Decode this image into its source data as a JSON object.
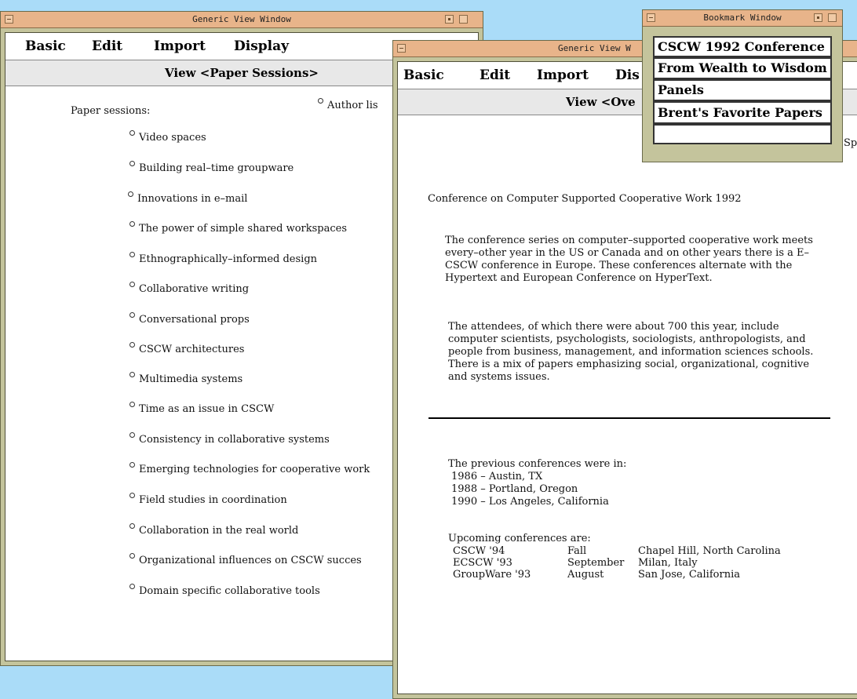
{
  "window1": {
    "title": "Generic View Window",
    "menu": [
      "Basic",
      "Edit",
      "Import",
      "Display"
    ],
    "view_title": "View <Paper Sessions>",
    "heading": "Paper sessions:",
    "author_link": "Author lis",
    "sessions": [
      "Video spaces",
      "Building real–time groupware",
      "Innovations in e–mail",
      "The power of simple shared workspaces",
      "Ethnographically–informed design",
      "Collaborative writing",
      "Conversational props",
      "CSCW architectures",
      "Multimedia systems",
      "Time as an issue in CSCW",
      "Consistency in collaborative systems",
      "Emerging technologies for cooperative work",
      "Field studies in coordination",
      "Collaboration in the real world",
      "Organizational influences on CSCW succes",
      "Domain specific collaborative tools"
    ]
  },
  "window2": {
    "title": "Generic View W",
    "menu": [
      "Basic",
      "Edit",
      "Import",
      "Dis"
    ],
    "view_title": "View <Ove",
    "corner_text": "Sp",
    "conference_title": "Conference on Computer Supported Cooperative Work 1992",
    "para1": "The conference series  on computer–supported cooperative work meets every–other year in the US or Canada and on other years there is a E–CSCW conference in Europe.  These conferences alternate with the Hypertext and European Conference on HyperText.",
    "para2": "The attendees, of which there were about 700 this year, include computer scientists, psychologists, sociologists, anthropologists, and people from business, management, and information sciences schools.  There is a mix of papers emphasizing social, organizational, cognitive and systems issues.",
    "previous_heading": "The previous conferences were in:",
    "previous": [
      "1986 – Austin, TX",
      "1988 – Portland, Oregon",
      "1990 – Los Angeles, California"
    ],
    "upcoming_heading": "Upcoming conferences are:",
    "upcoming": [
      {
        "name": "CSCW '94",
        "when": "Fall",
        "where": "Chapel Hill, North Carolina"
      },
      {
        "name": "ECSCW '93",
        "when": "September",
        "where": "Milan, Italy"
      },
      {
        "name": "GroupWare '93",
        "when": "August",
        "where": "San Jose, California"
      }
    ]
  },
  "bookmarks": {
    "title": "Bookmark Window",
    "items": [
      "CSCW 1992 Conference",
      "From Wealth to Wisdom",
      "Panels",
      "Brent's Favorite Papers",
      ""
    ]
  },
  "colors": {
    "desktop": "#aadcf8",
    "window_frame": "#c4c49c",
    "title_bar": "#e8b48a",
    "view_bar": "#e8e8e8"
  }
}
